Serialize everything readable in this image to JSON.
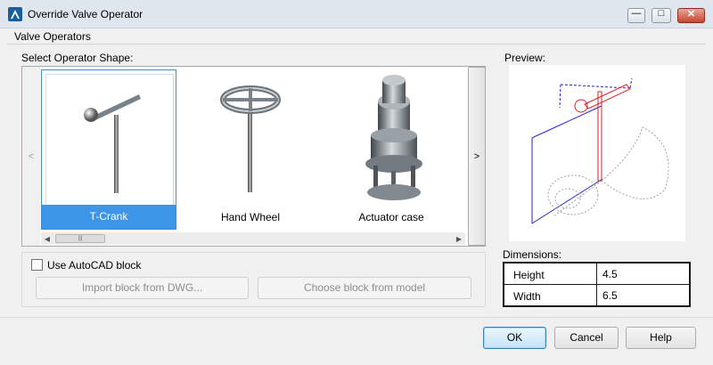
{
  "window": {
    "title": "Override Valve Operator",
    "controls": {
      "minimize": "—",
      "maximize": "□",
      "close": "✕"
    }
  },
  "group_title": "Valve Operators",
  "gallery": {
    "label": "Select Operator Shape:",
    "left_arrow": "<",
    "right_arrow": ">",
    "items": [
      {
        "label": "T-Crank",
        "selected": true,
        "icon": "t-crank-icon"
      },
      {
        "label": "Hand Wheel",
        "selected": false,
        "icon": "hand-wheel-icon"
      },
      {
        "label": "Actuator case",
        "selected": false,
        "icon": "actuator-case-icon"
      }
    ],
    "scroll_thumb": "|||"
  },
  "block": {
    "checkbox_label": "Use AutoCAD block",
    "checked": false,
    "import_label": "Import block from DWG...",
    "choose_label": "Choose block from model"
  },
  "preview": {
    "label": "Preview:"
  },
  "dimensions": {
    "label": "Dimensions:",
    "rows": [
      {
        "name": "Height",
        "value": "4.5"
      },
      {
        "name": "Width",
        "value": "6.5"
      }
    ]
  },
  "buttons": {
    "ok": "OK",
    "cancel": "Cancel",
    "help": "Help"
  },
  "colors": {
    "selection": "#3c95e6",
    "titlebar": "#dfe6ee",
    "preview_blue": "#2222cc",
    "preview_red": "#dd2222"
  }
}
